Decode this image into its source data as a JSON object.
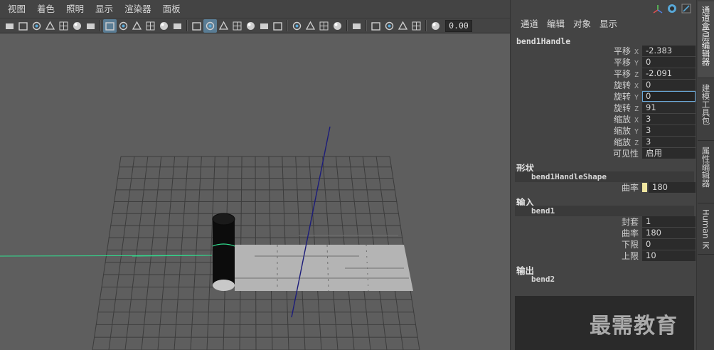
{
  "menu": {
    "items": [
      "视图",
      "着色",
      "照明",
      "显示",
      "渲染器",
      "面板"
    ]
  },
  "toolbar": {
    "value_field": "0.00",
    "icon_groups": [
      [
        "camera-icon",
        "lock-camera-icon",
        "bookmark-camera-icon",
        "image-plane-icon",
        "grease-pencil-icon",
        "2d-pan-icon",
        "brush-icon"
      ],
      [
        "grid-icon",
        "film-gate-icon",
        "resolution-gate-icon",
        "gate-mask-icon",
        "field-chart-icon",
        "safe-title-icon"
      ],
      [
        "wireframe-icon",
        "smooth-shade-icon",
        "default-material-icon",
        "textured-icon",
        "checker-icon",
        "lights-icon",
        "shadows-icon"
      ],
      [
        "ambient-occlusion-icon",
        "motion-blur-icon",
        "multisample-icon",
        "depth-of-field-icon"
      ],
      [
        "isolate-select-icon"
      ],
      [
        "xray-icon",
        "xray-joints-icon",
        "xray-components-icon",
        "backface-icon"
      ],
      [
        "exposure-icon"
      ]
    ]
  },
  "side_panel": {
    "menu": [
      "通道",
      "编辑",
      "对象",
      "显示"
    ],
    "node_name": "bend1Handle",
    "transform_attrs": [
      {
        "label": "平移",
        "axis": "X",
        "value": "-2.383"
      },
      {
        "label": "平移",
        "axis": "Y",
        "value": "0"
      },
      {
        "label": "平移",
        "axis": "Z",
        "value": "-2.091"
      },
      {
        "label": "旋转",
        "axis": "X",
        "value": "0"
      },
      {
        "label": "旋转",
        "axis": "Y",
        "value": "0",
        "focused": true
      },
      {
        "label": "旋转",
        "axis": "Z",
        "value": "91"
      },
      {
        "label": "缩放",
        "axis": "X",
        "value": "3"
      },
      {
        "label": "缩放",
        "axis": "Y",
        "value": "3"
      },
      {
        "label": "缩放",
        "axis": "Z",
        "value": "3"
      },
      {
        "label": "可见性",
        "axis": "",
        "value": "启用"
      }
    ],
    "shape_section": {
      "header": "形状",
      "node": "bend1HandleShape",
      "attrs": [
        {
          "label": "曲率",
          "value": "180",
          "swatch": "#f0e6a0"
        }
      ]
    },
    "input_section": {
      "header": "输入",
      "node": "bend1",
      "attrs": [
        {
          "label": "封套",
          "value": "1"
        },
        {
          "label": "曲率",
          "value": "180"
        },
        {
          "label": "下限",
          "value": "0"
        },
        {
          "label": "上限",
          "value": "10"
        }
      ]
    },
    "output_section": {
      "header": "输出",
      "node": "bend2"
    },
    "watermark": "最需教育"
  },
  "tabs": [
    "通道盒/层编辑器",
    "建模工具包",
    "属性编辑器",
    "Human IK"
  ],
  "colors": {
    "viewport_bg": "#5e5e5e",
    "panel_bg": "#444444",
    "field_bg": "#2b2b2b",
    "focus_border": "#6aa8d8",
    "grid_line": "#3c3c3c",
    "handle_line": "#1c1c7a",
    "selection_green": "#30e090"
  }
}
